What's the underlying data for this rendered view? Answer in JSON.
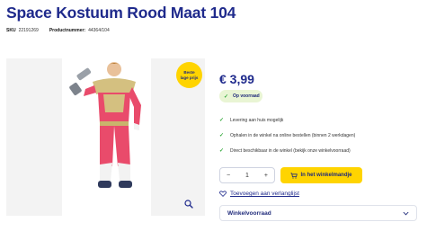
{
  "product": {
    "title": "Space Kostuum Rood Maat 104",
    "sku_label": "SKU",
    "sku_value": "22191269",
    "productnumber_label": "Productnummer:",
    "productnumber_value": "44364/104"
  },
  "gallery": {
    "badge_text_line1": "Beste",
    "badge_text_line2": "lage prijs"
  },
  "offer": {
    "price": "€ 3,99",
    "stock_label": "Op voorraad",
    "features": [
      "Levering aan huis mogelijk",
      "Ophalen in de winkel na online bestellen (binnen 2 werkdagen)",
      "Direct beschikbaar in de winkel (bekijk onze winkelvoorraad)"
    ],
    "quantity": "1",
    "minus_symbol": "−",
    "plus_symbol": "+",
    "add_to_cart_label": "In het winkelmandje",
    "wishlist_label": "Toevoegen aan verlanglijst",
    "store_stock_label": "Winkelvoorraad"
  },
  "colors": {
    "brand_blue": "#1f2a8c",
    "accent_yellow": "#ffd400",
    "check_green": "#2fa838",
    "stock_bg": "#e9f5d4"
  }
}
